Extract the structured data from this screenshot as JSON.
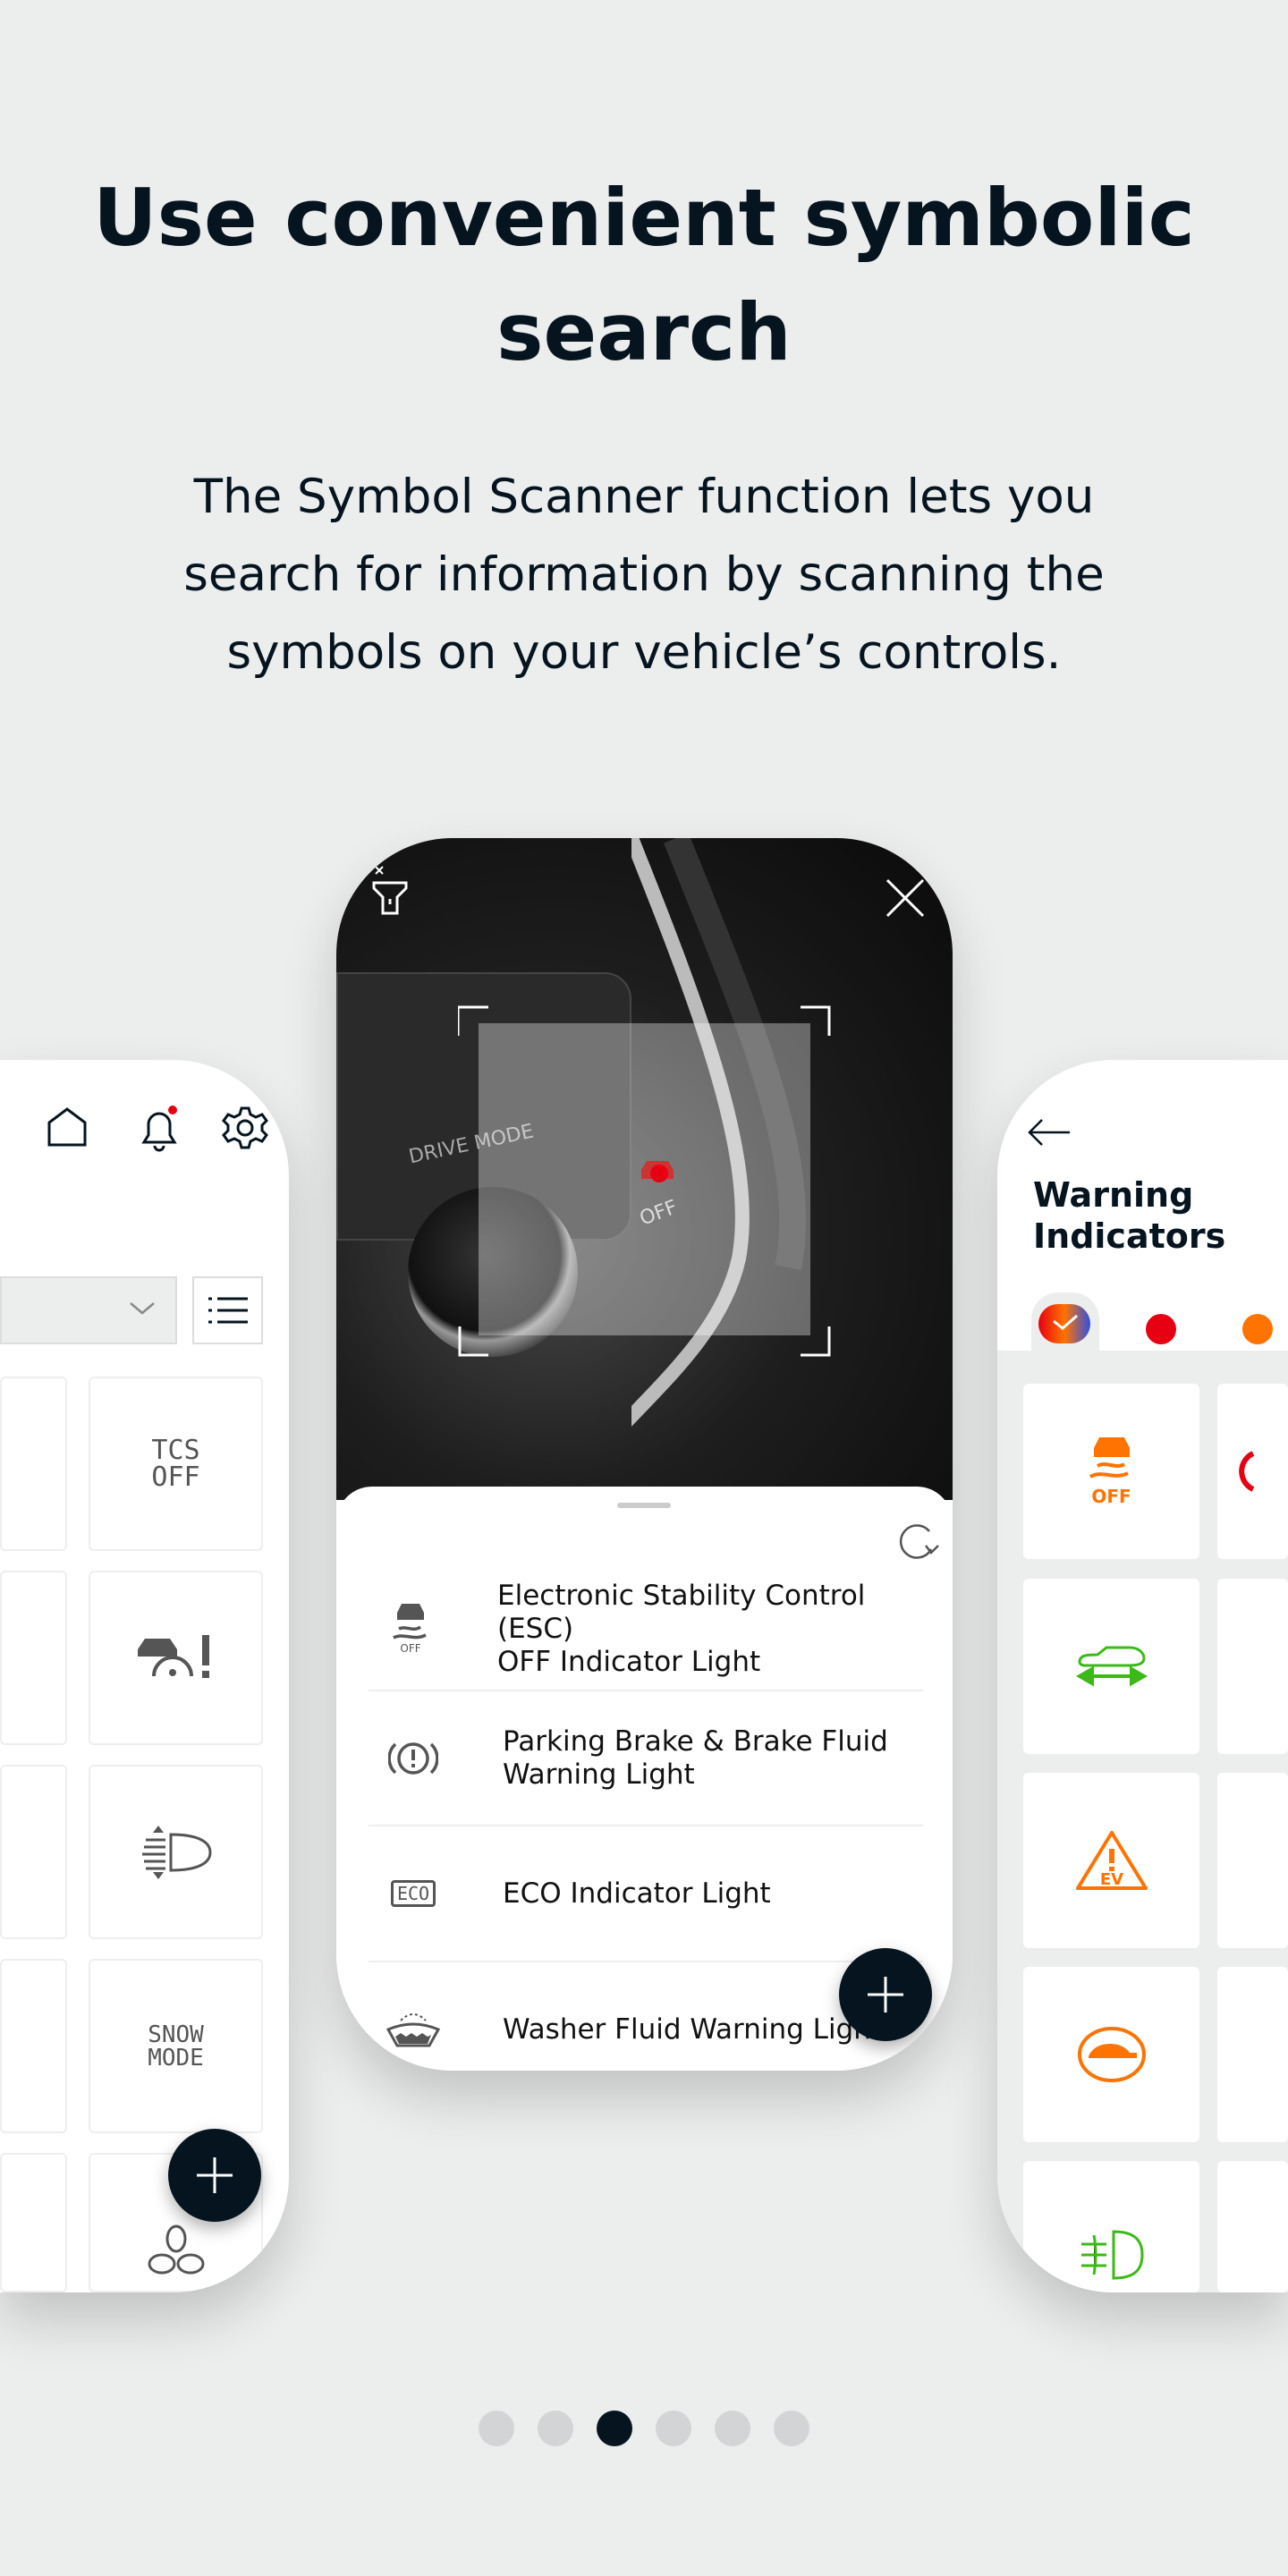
{
  "heading": {
    "title": "Use convenient symbolic search",
    "subtitle": "The Symbol Scanner function lets you search for information by scanning the symbols on your vehicle’s controls."
  },
  "left_phone": {
    "icons": [
      "home-icon",
      "bell-icon",
      "gear-icon"
    ],
    "notification_dot_color": "#e60012",
    "tiles": [
      {
        "label": "TCS OFF"
      },
      {
        "icon": "car-speedometer-warning-icon"
      },
      {
        "icon": "headlight-leveling-icon"
      },
      {
        "label": "SNOW MODE"
      },
      {
        "icon": "fan-icon"
      }
    ]
  },
  "center_phone": {
    "scanner_icons": [
      "flashlight-off-icon",
      "close-icon"
    ],
    "camera_labels": {
      "drive_mode": "DRIVE MODE",
      "esc_off": "OFF"
    },
    "results": [
      {
        "icon": "esc-off-icon",
        "icon_label": "OFF",
        "label_line1": "Electronic Stability Control (ESC)",
        "label_line2": "OFF Indicator Light"
      },
      {
        "icon": "brake-warning-icon",
        "label_line1": "Parking Brake & Brake Fluid",
        "label_line2": "Warning Light"
      },
      {
        "icon": "eco-icon",
        "icon_label": "ECO",
        "label_line1": "ECO Indicator Light"
      },
      {
        "icon": "washer-fluid-icon",
        "label_line1": "Washer Fluid Warning Light"
      }
    ]
  },
  "right_phone": {
    "title": "Warning Indicators",
    "filters": [
      {
        "color": "all",
        "selected": true
      },
      {
        "color": "#e60012"
      },
      {
        "color": "#ff7300"
      }
    ],
    "tiles": [
      {
        "icon": "esc-off-icon",
        "label": "OFF",
        "color": "#ff7300"
      },
      {
        "icon": "vehicle-distance-icon",
        "color": "#3cb918"
      },
      {
        "icon": "ev-warning-icon",
        "label": "EV",
        "color": "#ff7300"
      },
      {
        "icon": "turtle-mode-icon",
        "color": "#ff7300"
      },
      {
        "icon": "front-fog-light-icon",
        "color": "#3cb918"
      }
    ]
  },
  "pagination": {
    "total": 6,
    "active": 3,
    "active_color": "#05141f"
  }
}
